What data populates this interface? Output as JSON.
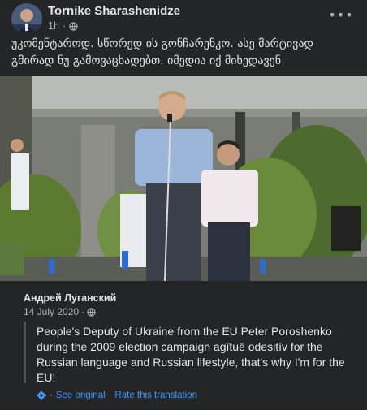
{
  "post": {
    "author": "Tornike Sharashenidze",
    "time": "1h",
    "visibility_icon": "globe-icon",
    "more_icon": "more-options-icon",
    "more_label": "•••",
    "text": "უკომენტაროდ. სწორედ ის გონჩარენკო. ასე მარტივად გმირად ნუ გამოვაცხადებთ. იმედია იქ მიხედავენ"
  },
  "shared": {
    "author": "Андрей Луганский",
    "date": "14 July 2020",
    "dot": "·",
    "visibility_icon": "globe-icon",
    "quote": "People's Deputy of Ukraine from the EU Peter Poroshenko during the 2009 election campaign agîtuê odesitív for the Russian language and Russian lifestyle, that's why I'm for the EU!",
    "see_original": "See original",
    "rate": "Rate this translation",
    "settings_icon": "gear-icon"
  },
  "colors": {
    "background": "#242526",
    "text": "#e4e6eb",
    "secondary_text": "#b0b3b8",
    "link": "#4599ff"
  }
}
